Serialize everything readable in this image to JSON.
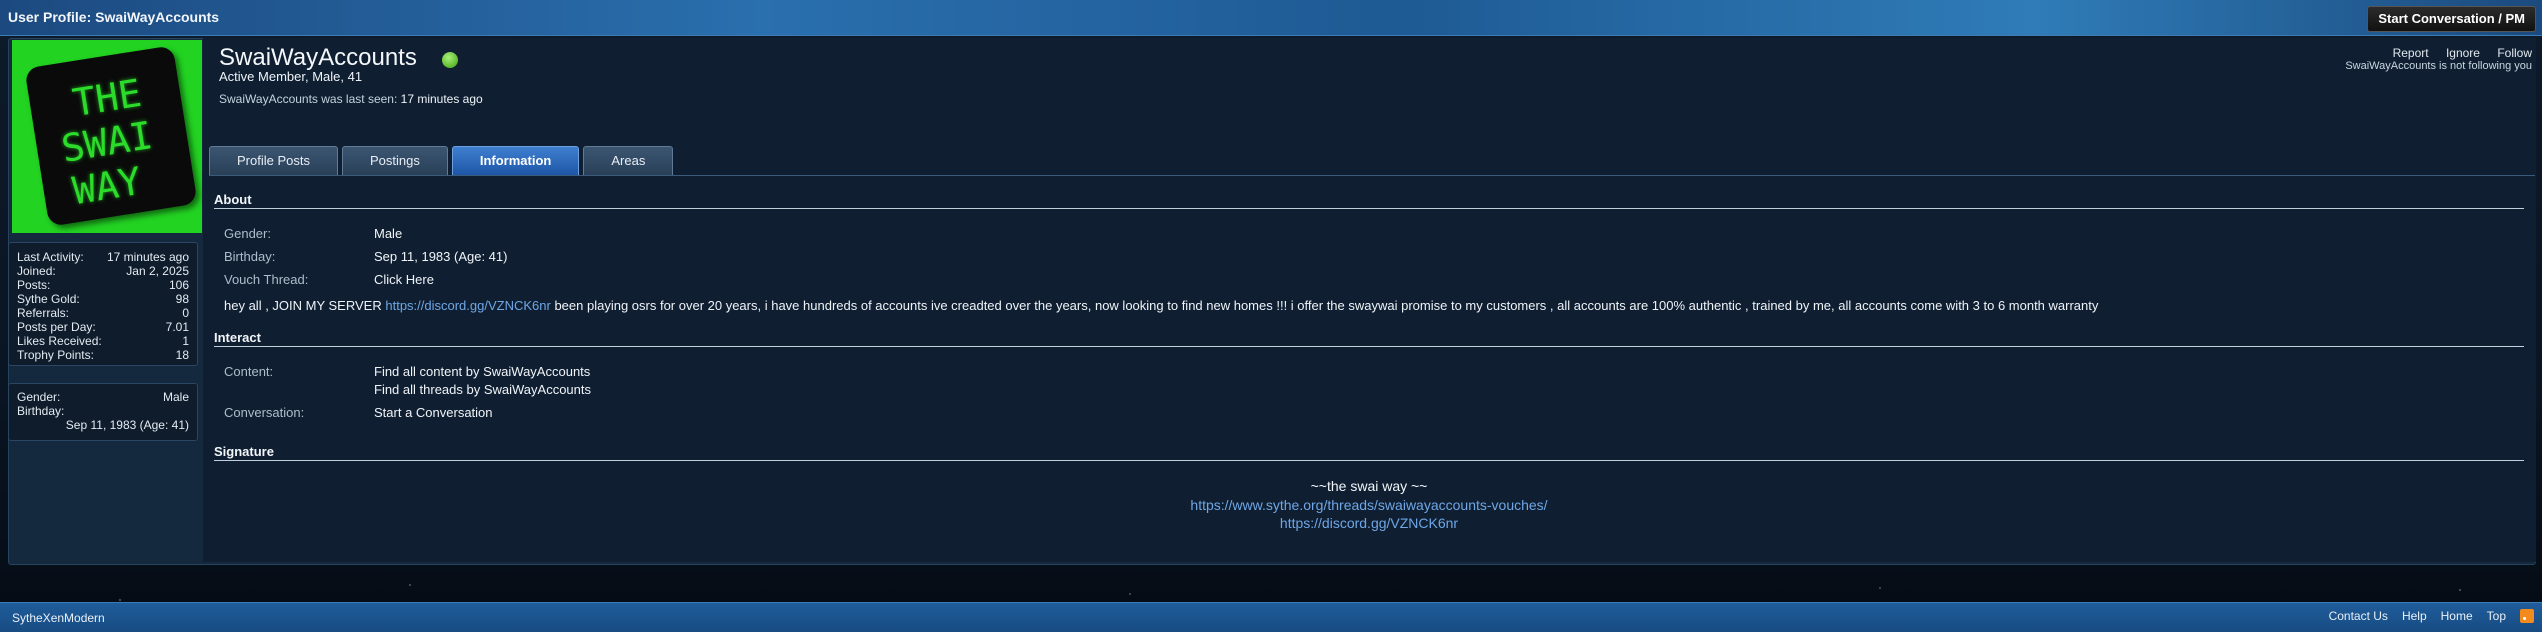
{
  "header": {
    "title": "User Profile: SwaiWayAccounts",
    "start_conversation_label": "Start Conversation / PM"
  },
  "avatar": {
    "lines": [
      "THE",
      "SWAI",
      "WAY"
    ]
  },
  "profile": {
    "username": "SwaiWayAccounts",
    "member_line": "Active Member, Male, 41",
    "last_seen_prefix": "SwaiWayAccounts was last seen:",
    "last_seen_value": "17 minutes ago",
    "actions": {
      "report": "Report",
      "ignore": "Ignore",
      "follow": "Follow"
    },
    "follow_note": "SwaiWayAccounts is not following you"
  },
  "stats": [
    {
      "label": "Last Activity:",
      "value": "17 minutes ago"
    },
    {
      "label": "Joined:",
      "value": "Jan 2, 2025"
    },
    {
      "label": "Posts:",
      "value": "106"
    },
    {
      "label": "Sythe Gold:",
      "value": "98"
    },
    {
      "label": "Referrals:",
      "value": "0"
    },
    {
      "label": "Posts per Day:",
      "value": "7.01"
    },
    {
      "label": "Likes Received:",
      "value": "1"
    },
    {
      "label": "Trophy Points:",
      "value": "18"
    }
  ],
  "sidebar_info": {
    "gender_label": "Gender:",
    "gender_value": "Male",
    "birthday_label": "Birthday:",
    "birthday_value": "Sep 11, 1983 (Age: 41)"
  },
  "tabs": [
    {
      "label": "Profile Posts",
      "active": false
    },
    {
      "label": "Postings",
      "active": false
    },
    {
      "label": "Information",
      "active": true
    },
    {
      "label": "Areas",
      "active": false
    }
  ],
  "about": {
    "heading": "About",
    "gender_label": "Gender:",
    "gender_value": "Male",
    "birthday_label": "Birthday:",
    "birthday_value": "Sep 11, 1983 (Age: 41)",
    "vouch_label": "Vouch Thread:",
    "vouch_value": "Click Here",
    "text_before": "hey all , JOIN MY SERVER ",
    "text_link": "https://discord.gg/VZNCK6nr",
    "text_after": " been playing osrs for over 20 years, i have hundreds of accounts ive creadted over the years, now looking to find new homes !!! i offer the swaywai promise to my customers , all accounts are 100% authentic , trained by me, all accounts come with 3 to 6 month warranty"
  },
  "interact": {
    "heading": "Interact",
    "content_label": "Content:",
    "content_link1": "Find all content by SwaiWayAccounts",
    "content_link2": "Find all threads by SwaiWayAccounts",
    "conversation_label": "Conversation:",
    "conversation_link": "Start a Conversation"
  },
  "signature": {
    "heading": "Signature",
    "line1": "~~the swai way ~~",
    "line2": "https://www.sythe.org/threads/swaiwayaccounts-vouches/",
    "line3": "https://discord.gg/VZNCK6nr"
  },
  "footer": {
    "brand": "SytheXenModern",
    "links": [
      "Contact Us",
      "Help",
      "Home",
      "Top"
    ]
  },
  "colors": {
    "accent": "#2a6fae",
    "active_tab": "#1e56a6",
    "link": "#6fa6e6",
    "online": "#5eb82c",
    "avatar_bg": "#22d322"
  }
}
